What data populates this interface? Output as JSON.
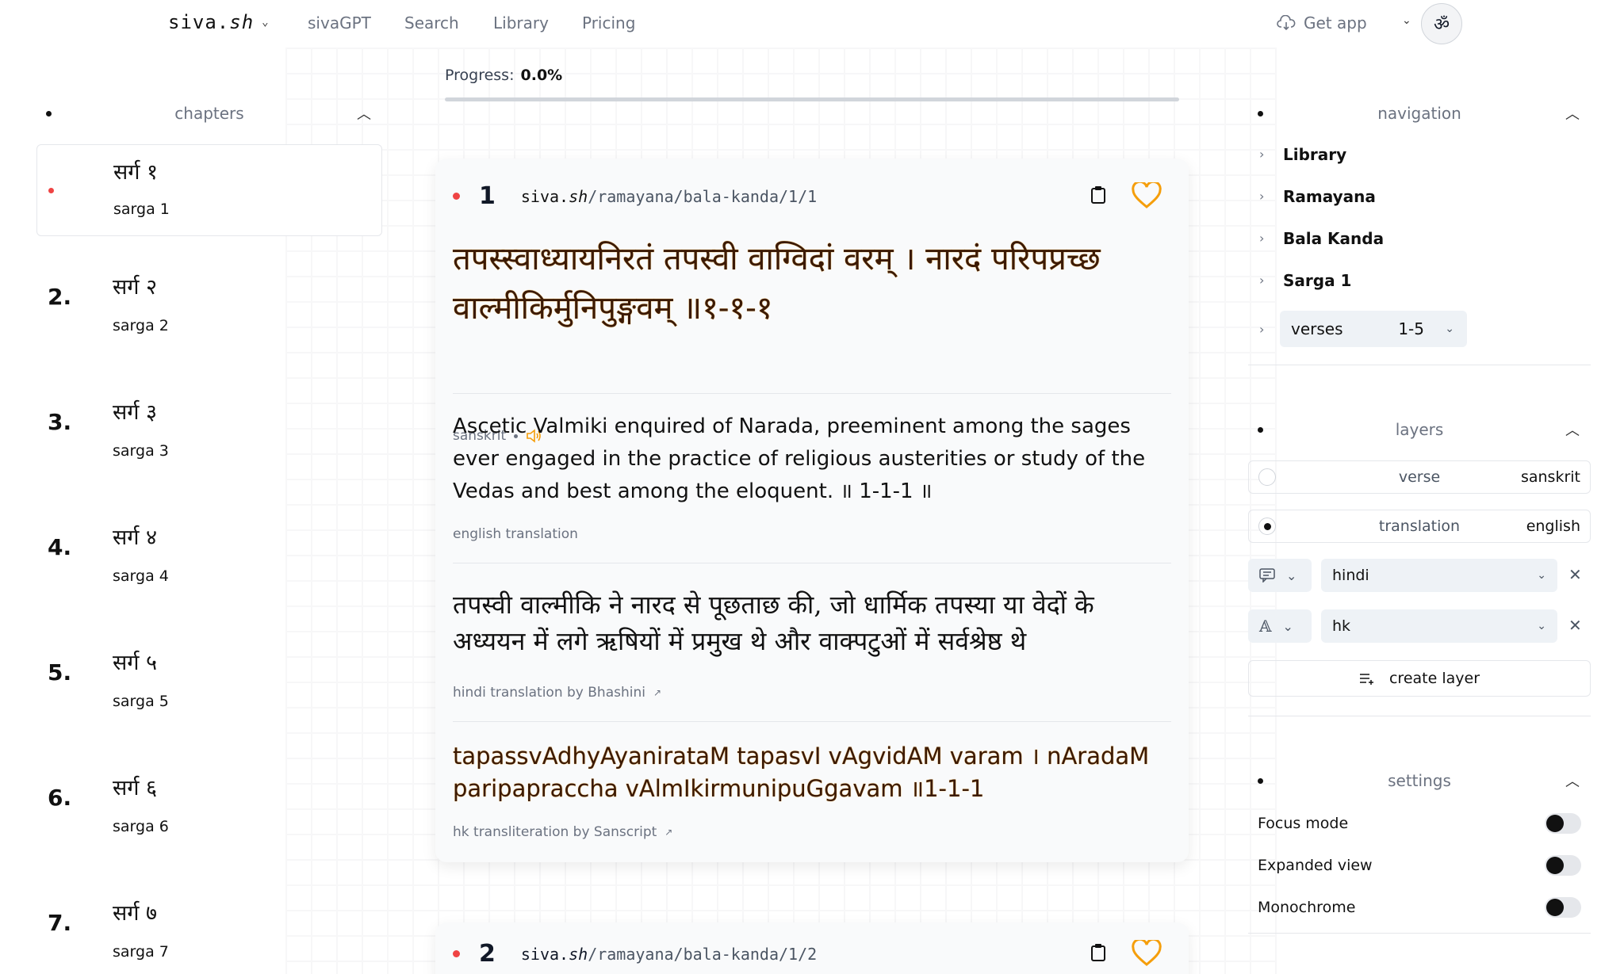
{
  "topnav": {
    "brand_main": "siva.",
    "brand_italic": "sh",
    "links": [
      "sivaGPT",
      "Search",
      "Library",
      "Pricing"
    ],
    "get_app": "Get app",
    "om": "ॐ"
  },
  "chapters": {
    "heading": "chapters",
    "items": [
      {
        "num": "",
        "devanagari": "सर्ग १",
        "latin": "sarga 1"
      },
      {
        "num": "2.",
        "devanagari": "सर्ग २",
        "latin": "sarga 2"
      },
      {
        "num": "3.",
        "devanagari": "सर्ग ३",
        "latin": "sarga 3"
      },
      {
        "num": "4.",
        "devanagari": "सर्ग ४",
        "latin": "sarga 4"
      },
      {
        "num": "5.",
        "devanagari": "सर्ग ५",
        "latin": "sarga 5"
      },
      {
        "num": "6.",
        "devanagari": "सर्ग ६",
        "latin": "sarga 6"
      },
      {
        "num": "7.",
        "devanagari": "सर्ग ७",
        "latin": "sarga 7"
      }
    ]
  },
  "progress": {
    "label": "Progress:",
    "value": "0.0%",
    "fraction": 0.0
  },
  "verse1": {
    "number": "1",
    "path_brand": "siva.",
    "path_italic": "sh",
    "path_rest": "/ramayana/bala-kanda/1/1",
    "sanskrit": "तपस्स्वाध्यायनिरतं तपस्वी वाग्विदां वरम्  । नारदं परिपप्रच्छ वाल्मीकिर्मुनिपुङ्गवम्  ॥१-१-१",
    "sanskrit_label": "sanskrit",
    "english": "Ascetic Valmiki enquired of Narada, preeminent among the sages ever engaged in the practice of religious austerities or study of the Vedas and best among the eloquent.  ॥ 1-1-1 ॥",
    "english_label": "english translation",
    "hindi": "तपस्वी वाल्मीकि ने नारद से पूछताछ की, जो धार्मिक तपस्या या वेदों के अध्ययन में लगे ऋषियों में प्रमुख थे और वाक्पटुओं में सर्वश्रेष्ठ थे",
    "hindi_label": "hindi translation by Bhashini",
    "hk": "tapassvAdhyAyaniratаM tapasvI vAgvidAM varam  । nAradaM paripapraccha vAlmIkirmunipuGgavam  ॥1-1-1",
    "hk_label": "hk transliteration by Sanscript",
    "ext_arrow": "↗"
  },
  "verse2": {
    "number": "2",
    "path_brand": "siva.",
    "path_italic": "sh",
    "path_rest": "/ramayana/bala-kanda/1/2"
  },
  "navigation": {
    "heading": "navigation",
    "crumbs": [
      "Library",
      "Ramayana",
      "Bala Kanda",
      "Sarga 1"
    ],
    "verses_label": "verses",
    "verses_range": "1-5"
  },
  "layers": {
    "heading": "layers",
    "rows": [
      {
        "name": "verse",
        "value": "sanskrit"
      },
      {
        "name": "translation",
        "value": "english"
      }
    ],
    "select1": "hindi",
    "select2": "hk",
    "create": "create layer"
  },
  "settings": {
    "heading": "settings",
    "toggles": [
      "Focus mode",
      "Expanded view",
      "Monochrome"
    ]
  },
  "colors": {
    "accent_orange": "#f59e0b",
    "active_red": "#ef4444"
  }
}
